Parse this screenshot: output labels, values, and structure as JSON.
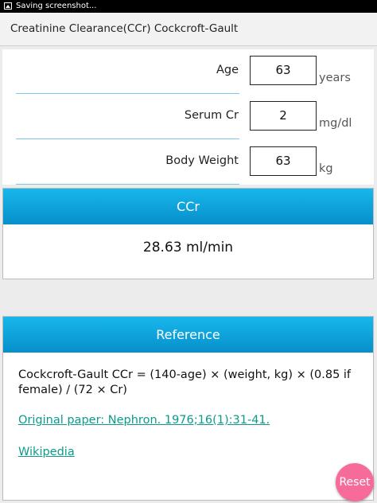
{
  "status_bar": {
    "text": "Saving screenshot...",
    "icon": "image-icon"
  },
  "app_bar": {
    "title": "Creatinine Clearance(CCr) Cockcroft-Gault"
  },
  "inputs": [
    {
      "label": "Age",
      "value": "63",
      "unit": "years"
    },
    {
      "label": "Serum Cr",
      "value": "2",
      "unit": "mg/dl"
    },
    {
      "label": "Body Weight",
      "value": "63",
      "unit": "kg"
    }
  ],
  "result": {
    "header": "CCr",
    "value": "28.63 ml/min"
  },
  "reference": {
    "header": "Reference",
    "formula": "Cockcroft-Gault CCr = (140-age) × (weight, kg) × (0.85 if female) / (72 × Cr)",
    "paper_link": "Original paper: Nephron. 1976;16(1):31-41.",
    "wiki_link": "Wikipedia"
  },
  "reset_button": {
    "label": "Reset"
  },
  "colors": {
    "accent": "#0d9fd9",
    "link": "#0c9a8a",
    "fab": "#f76b9a",
    "underline": "#7ec8e6"
  }
}
